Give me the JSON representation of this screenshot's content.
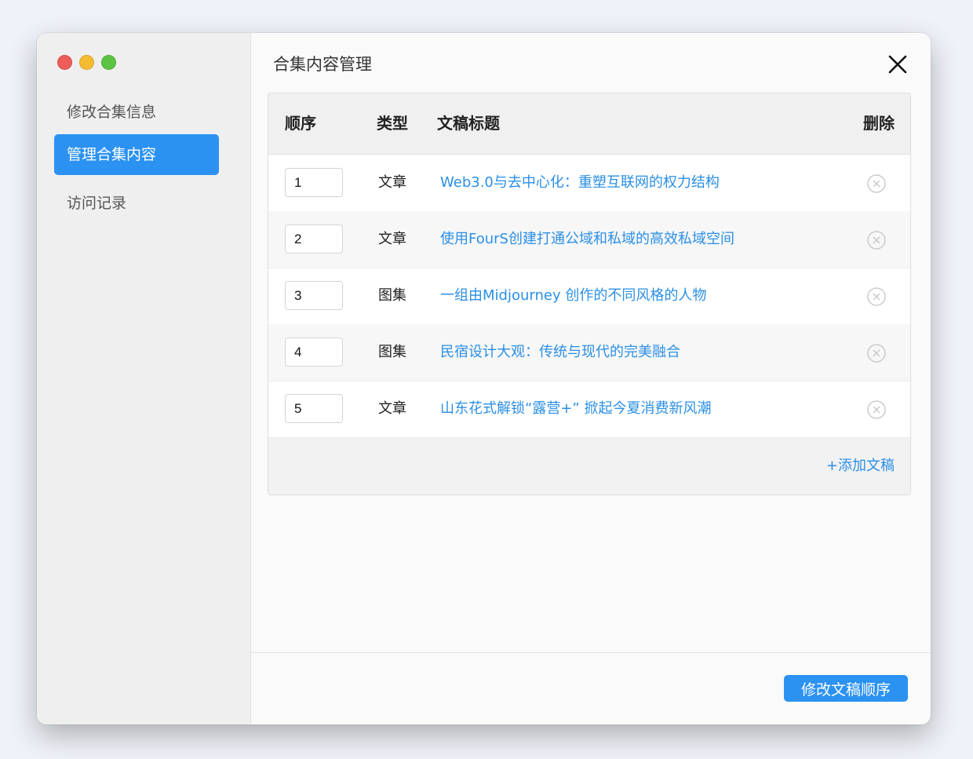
{
  "colors": {
    "accent": "#2b92f2",
    "link": "#2b8fe6",
    "traffic_red": "#ee5d57",
    "traffic_yellow": "#f5bb31",
    "traffic_green": "#5bc541"
  },
  "sidebar": {
    "items": [
      {
        "label": "修改合集信息",
        "active": false
      },
      {
        "label": "管理合集内容",
        "active": true
      },
      {
        "label": "访问记录",
        "active": false
      }
    ]
  },
  "main": {
    "title": "合集内容管理",
    "close_icon": "close-icon"
  },
  "table": {
    "headers": {
      "order": "顺序",
      "type": "类型",
      "title": "文稿标题",
      "delete": "删除"
    },
    "rows": [
      {
        "order": "1",
        "type": "文章",
        "title": "Web3.0与去中心化：重塑互联网的权力结构"
      },
      {
        "order": "2",
        "type": "文章",
        "title": "使用FourS创建打通公域和私域的高效私域空间"
      },
      {
        "order": "3",
        "type": "图集",
        "title": "一组由Midjourney 创作的不同风格的人物"
      },
      {
        "order": "4",
        "type": "图集",
        "title": "民宿设计大观：传统与现代的完美融合"
      },
      {
        "order": "5",
        "type": "文章",
        "title": "山东花式解锁“露营+” 掀起今夏消费新风潮"
      }
    ],
    "delete_icon": "circle-x-icon",
    "add_label": "+添加文稿"
  },
  "footer": {
    "submit_label": "修改文稿顺序"
  }
}
